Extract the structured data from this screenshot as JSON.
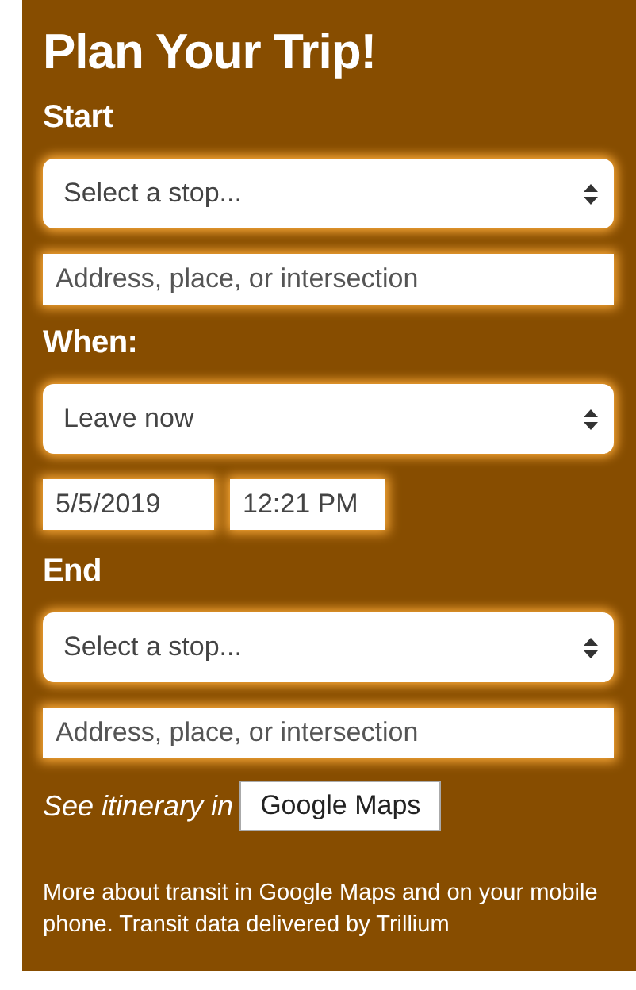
{
  "title": "Plan Your Trip!",
  "sections": [
    {
      "kind": "stop",
      "heading": "Start",
      "select": {
        "value": "Select a stop..."
      },
      "address": {
        "placeholder": "Address, place, or intersection"
      }
    },
    {
      "kind": "when",
      "heading": "When:",
      "select": {
        "value": "Leave now"
      },
      "date": "5/5/2019",
      "time": "12:21 PM"
    },
    {
      "kind": "stop",
      "heading": "End",
      "select": {
        "value": "Select a stop..."
      },
      "address": {
        "placeholder": "Address, place, or intersection"
      }
    }
  ],
  "itinerary": {
    "label": "See itinerary in",
    "button": "Google Maps"
  },
  "footer": "More about transit in Google Maps and on your mobile phone. Transit data delivered by Trillium"
}
